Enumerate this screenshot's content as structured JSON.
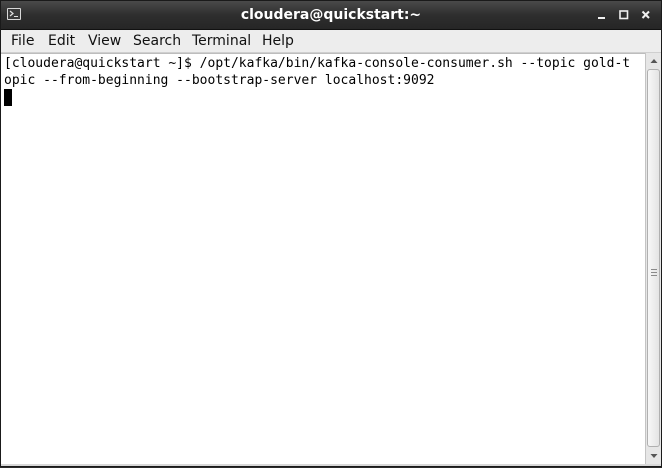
{
  "window": {
    "title": "cloudera@quickstart:~",
    "app_icon": "terminal-icon",
    "controls": {
      "minimize": "minimize-icon",
      "maximize": "maximize-icon",
      "close": "close-icon"
    }
  },
  "menubar": {
    "items": [
      {
        "label": "File"
      },
      {
        "label": "Edit"
      },
      {
        "label": "View"
      },
      {
        "label": "Search"
      },
      {
        "label": "Terminal"
      },
      {
        "label": "Help"
      }
    ]
  },
  "terminal": {
    "lines": [
      "[cloudera@quickstart ~]$ /opt/kafka/bin/kafka-console-consumer.sh --topic gold-t",
      "opic --from-beginning --bootstrap-server localhost:9092"
    ]
  },
  "colors": {
    "titlebar": "#2e2e2e",
    "terminal_bg": "#ffffff",
    "terminal_fg": "#000000",
    "menubar_bg": "#ededed"
  }
}
